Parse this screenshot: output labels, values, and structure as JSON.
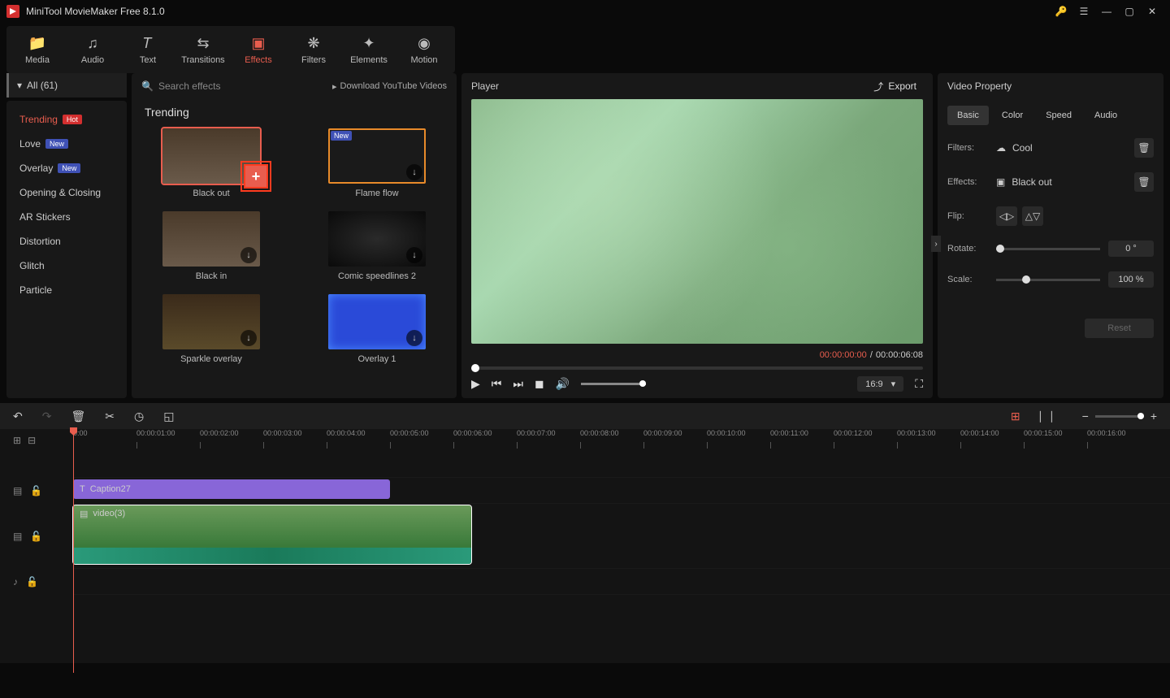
{
  "app": {
    "title": "MiniTool MovieMaker Free 8.1.0"
  },
  "mainTabs": [
    {
      "id": "media",
      "label": "Media",
      "icon": "📁"
    },
    {
      "id": "audio",
      "label": "Audio",
      "icon": "♪"
    },
    {
      "id": "text",
      "label": "Text",
      "icon": "T"
    },
    {
      "id": "transitions",
      "label": "Transitions",
      "icon": "⇄"
    },
    {
      "id": "effects",
      "label": "Effects",
      "icon": "▣",
      "active": true
    },
    {
      "id": "filters",
      "label": "Filters",
      "icon": "❋"
    },
    {
      "id": "elements",
      "label": "Elements",
      "icon": "✦"
    },
    {
      "id": "motion",
      "label": "Motion",
      "icon": "◉"
    }
  ],
  "categories": {
    "header": "All (61)",
    "items": [
      {
        "label": "Trending",
        "badge": "Hot",
        "badgeType": "hot",
        "active": true
      },
      {
        "label": "Love",
        "badge": "New",
        "badgeType": "new"
      },
      {
        "label": "Overlay",
        "badge": "New",
        "badgeType": "new"
      },
      {
        "label": "Opening & Closing"
      },
      {
        "label": "AR Stickers"
      },
      {
        "label": "Distortion"
      },
      {
        "label": "Glitch"
      },
      {
        "label": "Particle"
      }
    ]
  },
  "effects": {
    "searchPlaceholder": "Search effects",
    "downloadLink": "Download YouTube Videos",
    "sectionTitle": "Trending",
    "items": [
      {
        "name": "Black out",
        "selected": true,
        "addable": true
      },
      {
        "name": "Flame flow",
        "newBadge": true,
        "dl": true
      },
      {
        "name": "Black in",
        "dl": true
      },
      {
        "name": "Comic speedlines 2",
        "dl": true
      },
      {
        "name": "Sparkle overlay",
        "dl": true
      },
      {
        "name": "Overlay 1",
        "dl": true
      }
    ]
  },
  "player": {
    "title": "Player",
    "exportLabel": "Export",
    "currentTime": "00:00:00:00",
    "sep": " / ",
    "totalTime": "00:00:06:08",
    "ratio": "16:9"
  },
  "properties": {
    "title": "Video Property",
    "tabs": [
      {
        "label": "Basic",
        "active": true
      },
      {
        "label": "Color"
      },
      {
        "label": "Speed"
      },
      {
        "label": "Audio"
      }
    ],
    "filters": {
      "label": "Filters:",
      "value": "Cool"
    },
    "effectsRow": {
      "label": "Effects:",
      "value": "Black out"
    },
    "flip": {
      "label": "Flip:"
    },
    "rotate": {
      "label": "Rotate:",
      "value": "0 °"
    },
    "scale": {
      "label": "Scale:",
      "value": "100 %"
    },
    "reset": "Reset"
  },
  "timeline": {
    "ticks": [
      "0:00",
      "00:00:01:00",
      "00:00:02:00",
      "00:00:03:00",
      "00:00:04:00",
      "00:00:05:00",
      "00:00:06:00",
      "00:00:07:00",
      "00:00:08:00",
      "00:00:09:00",
      "00:00:10:00",
      "00:00:11:00",
      "00:00:12:00",
      "00:00:13:00",
      "00:00:14:00",
      "00:00:15:00",
      "00:00:16:00"
    ],
    "captionClip": "Caption27",
    "videoClip": "video(3)"
  }
}
